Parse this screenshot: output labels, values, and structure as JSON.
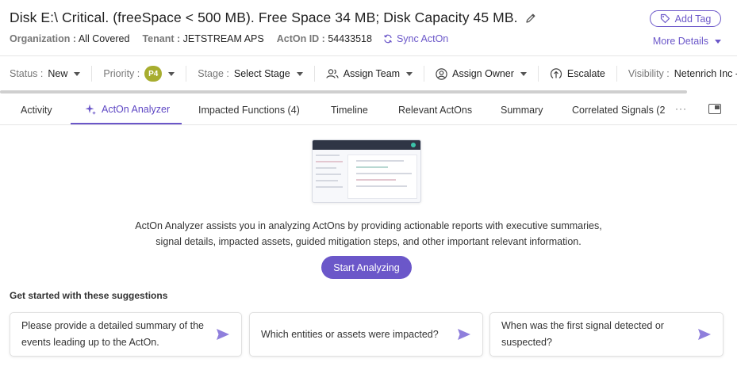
{
  "header": {
    "title": "Disk E:\\ Critical. (freeSpace < 500 MB). Free Space 34 MB; Disk Capacity 45 MB.",
    "add_tag": "Add Tag",
    "more_details": "More Details",
    "meta": {
      "organization_key": "Organization :",
      "organization_val": "All Covered",
      "tenant_key": "Tenant :",
      "tenant_val": "JETSTREAM APS",
      "acton_key": "ActOn ID :",
      "acton_val": "54433518",
      "sync": "Sync ActOn"
    }
  },
  "status_bar": {
    "status_key": "Status :",
    "status_val": "New",
    "priority_key": "Priority :",
    "priority_val": "P4",
    "stage_key": "Stage :",
    "stage_val": "Select Stage",
    "assign_team": "Assign Team",
    "assign_owner": "Assign Owner",
    "escalate": "Escalate",
    "visibility_key": "Visibility :",
    "visibility_val": "Netenrich Inc -"
  },
  "tabs": {
    "activity": "Activity",
    "acton_analyzer": "ActOn Analyzer",
    "impacted_functions": "Impacted Functions (4)",
    "timeline": "Timeline",
    "relevant_actons": "Relevant ActOns",
    "summary": "Summary",
    "correlated_signals": "Correlated Signals (2",
    "more": "···"
  },
  "analyzer": {
    "description_line1": "ActOn Analyzer assists you in analyzing ActOns by providing actionable reports with executive summaries,",
    "description_line2": "signal details, impacted assets, guided mitigation steps, and other important relevant information.",
    "start_button": "Start Analyzing",
    "suggestions_title": "Get started with these suggestions",
    "suggestions": [
      "Please provide a detailed summary of the events leading up to the ActOn.",
      "Which entities or assets were impacted?",
      "When was the first signal detected or suspected?"
    ]
  },
  "colors": {
    "accent": "#6b57c9",
    "priority_badge": "#a7ad2f"
  }
}
